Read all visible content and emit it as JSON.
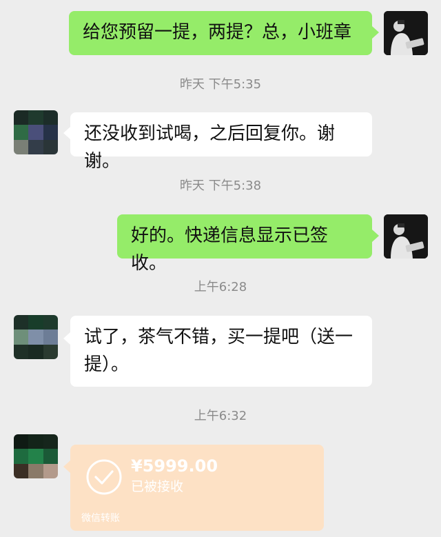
{
  "messages": [
    {
      "side": "out",
      "text": "给您预留一提，两提？总，小班章"
    },
    {
      "timestamp": "昨天 下午5:35"
    },
    {
      "side": "in",
      "text": "还没收到试喝，之后回复你。谢谢。"
    },
    {
      "timestamp": "昨天 下午5:38"
    },
    {
      "side": "out",
      "text": "好的。快递信息显示已签收。"
    },
    {
      "timestamp": "上午6:28"
    },
    {
      "side": "in",
      "text": "试了，茶气不错，买一提吧（送一提）。"
    },
    {
      "timestamp": "上午6:32"
    }
  ],
  "transfer": {
    "amount": "¥5999.00",
    "status": "已被接收",
    "footer": "微信转账"
  },
  "colors": {
    "background": "#ededed",
    "outgoing_bubble": "#95ec69",
    "incoming_bubble": "#ffffff",
    "transfer_card": "#fde1c5",
    "timestamp_text": "#8a8a8a"
  },
  "contact_avatar_mosaic": [
    [
      "#1b2a25",
      "#1f3a2e",
      "#1c2d29",
      "#2f6b45",
      "#4a4f7a",
      "#263248",
      "#7a7f76",
      "#333d49",
      "#2a3538"
    ],
    [
      "#1d3028",
      "#183d2a",
      "#1e3a2c",
      "#6e8f7a",
      "#7f8fa8",
      "#6d7d96",
      "#1f3027",
      "#1a2a22",
      "#2a3a30"
    ],
    [
      "#0f1a14",
      "#132419",
      "#16261c",
      "#1e6b3f",
      "#23824a",
      "#1b5a37",
      "#3b2f25",
      "#8a7a69",
      "#b39a8b"
    ]
  ]
}
